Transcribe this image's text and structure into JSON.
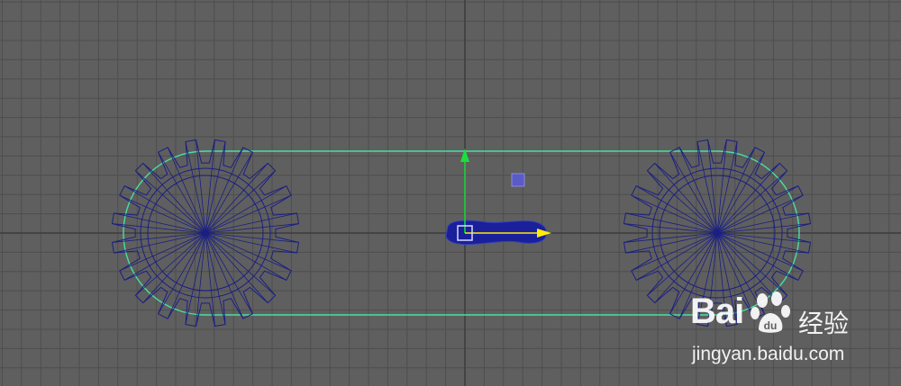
{
  "viewport": {
    "name": "3d-viewport",
    "background": "#5f5f5f",
    "grid_color": "#4e4e4e",
    "axis_line_color": "#3c3c3c"
  },
  "colors": {
    "wireframe": "#1a1f82",
    "chain_path": "#46e0a0",
    "gizmo_y": "#18e23a",
    "gizmo_x": "#ffee00",
    "selection": "#1a1f9a",
    "pivot_box": "#d8d8ff",
    "locator": "#5a5ac8"
  },
  "scene": {
    "left_gear": {
      "name": "left-gear",
      "teeth": 20
    },
    "right_gear": {
      "name": "right-gear",
      "teeth": 20
    },
    "chain_path": {
      "name": "chain-path-curve"
    },
    "selected_link": {
      "name": "chain-link-selected"
    },
    "move_gizmo": {
      "name": "move-manipulator",
      "axes": [
        "y",
        "x"
      ]
    }
  },
  "watermark": {
    "brand": "Bai",
    "brand_suffix": "",
    "cn_text": "经验",
    "url": "jingyan.baidu.com",
    "icon": "baidu-paw-icon"
  }
}
